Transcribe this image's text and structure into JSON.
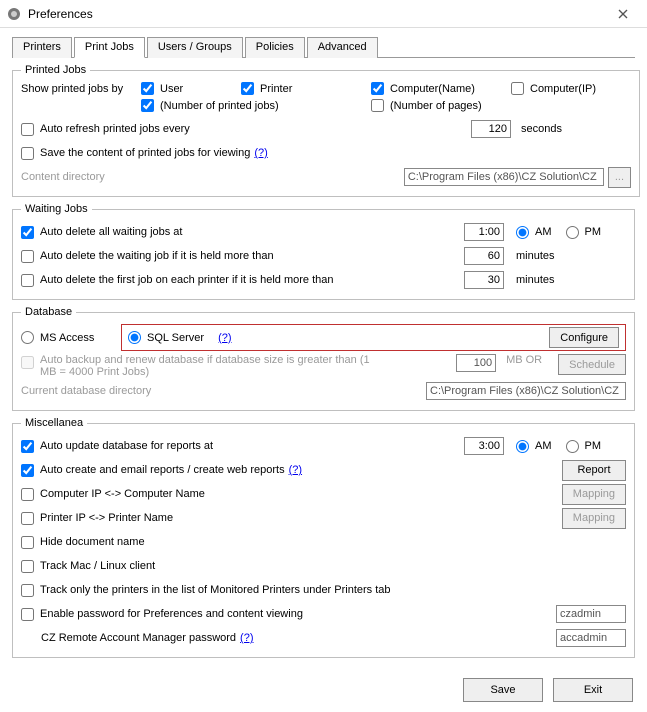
{
  "window": {
    "title": "Preferences"
  },
  "tabs": [
    "Printers",
    "Print Jobs",
    "Users / Groups",
    "Policies",
    "Advanced"
  ],
  "activeTab": 1,
  "printedJobs": {
    "legend": "Printed Jobs",
    "showLabel": "Show printed jobs by",
    "opts": {
      "user": "User",
      "printer": "Printer",
      "computerName": "Computer(Name)",
      "computerIP": "Computer(IP)",
      "numJobs": "(Number of printed jobs)",
      "numPages": "(Number of pages)"
    },
    "autoRefreshLabel": "Auto refresh printed jobs every",
    "autoRefreshValue": "120",
    "secondsLabel": "seconds",
    "saveContentLabel": "Save the content of printed jobs for viewing",
    "help": "(?)",
    "contentDirLabel": "Content directory",
    "contentDirValue": "C:\\Program Files (x86)\\CZ Solution\\CZ",
    "browseLabel": "..."
  },
  "waitingJobs": {
    "legend": "Waiting Jobs",
    "autoDeleteAllLabel": "Auto delete all waiting jobs at",
    "autoDeleteAllTime": "1:00",
    "am": "AM",
    "pm": "PM",
    "holdMoreThanLabel": "Auto delete the waiting job if it is held more than",
    "holdMoreThanValue": "60",
    "minutesLabel": "minutes",
    "firstJobLabel": "Auto delete the first job on each printer if it is held more than",
    "firstJobValue": "30"
  },
  "database": {
    "legend": "Database",
    "msAccess": "MS Access",
    "sqlServer": "SQL Server",
    "help": "(?)",
    "configure": "Configure",
    "autoBackupLabel": "Auto backup and renew database if database size is greater than (1 MB = 4000 Print Jobs)",
    "autoBackupValue": "100",
    "mbOr": "MB  OR",
    "schedule": "Schedule",
    "currentDirLabel": "Current database directory",
    "currentDirValue": "C:\\Program Files (x86)\\CZ Solution\\CZ"
  },
  "misc": {
    "legend": "Miscellanea",
    "autoUpdateLabel": "Auto update database for reports at",
    "autoUpdateTime": "3:00",
    "am": "AM",
    "pm": "PM",
    "autoCreateLabel": "Auto create and email reports / create web reports",
    "help": "(?)",
    "report": "Report",
    "compIpLabel": "Computer IP <-> Computer Name",
    "mapping": "Mapping",
    "printerIpLabel": "Printer IP <-> Printer Name",
    "hideDocLabel": "Hide document name",
    "trackMacLabel": "Track Mac / Linux client",
    "trackOnlyLabel": "Track only the printers in the list of Monitored Printers under Printers tab",
    "enablePwdLabel": "Enable password for Preferences and content viewing",
    "enablePwdValue": "czadmin",
    "czRemoteLabel": "CZ Remote Account Manager password",
    "czRemoteValue": "accadmin"
  },
  "footer": {
    "save": "Save",
    "exit": "Exit"
  }
}
